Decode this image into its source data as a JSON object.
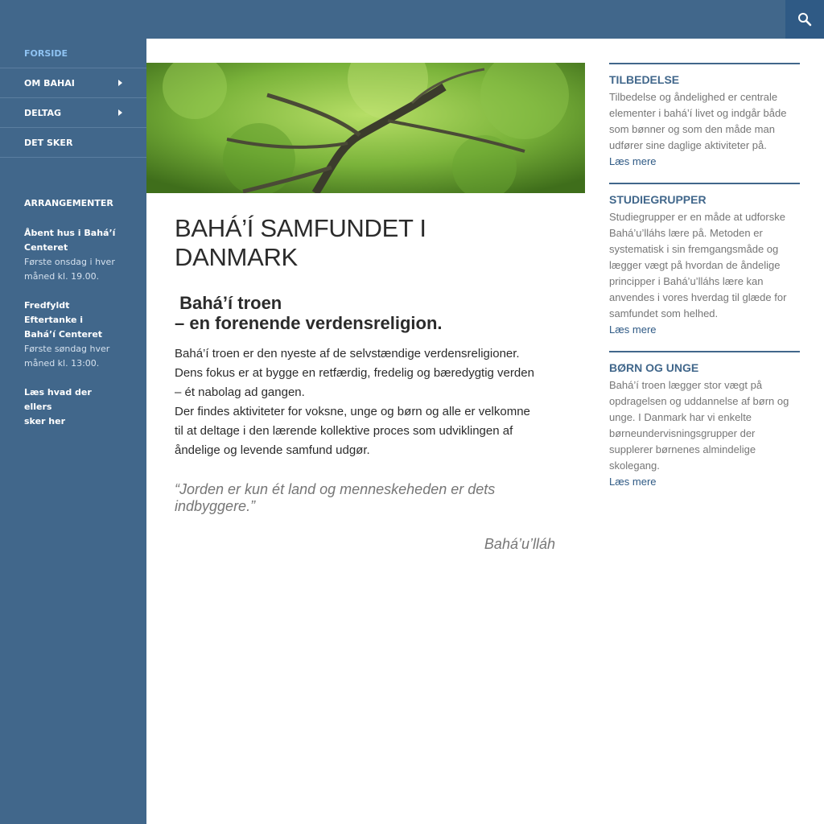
{
  "search": {
    "icon": "search-icon"
  },
  "nav": {
    "items": [
      {
        "label": "FORSIDE",
        "active": true,
        "has_submenu": false
      },
      {
        "label": "OM BAHAI",
        "active": false,
        "has_submenu": true
      },
      {
        "label": "DELTAG",
        "active": false,
        "has_submenu": true
      },
      {
        "label": "DET SKER",
        "active": false,
        "has_submenu": false
      }
    ]
  },
  "sidebar_widget": {
    "heading": "ARRANGEMENTER",
    "events": [
      {
        "title_lines": [
          "Åbent hus i Bahá’í",
          "Centeret"
        ],
        "time_lines": [
          "Første onsdag i hver",
          "måned kl. 19.00."
        ]
      },
      {
        "title_lines": [
          "Fredfyldt Eftertanke i",
          "Bahá’í Centeret"
        ],
        "time_lines": [
          "Første søndag hver",
          "måned kl. 13:00."
        ]
      }
    ],
    "more_link_lines": [
      "Læs hvad der ellers",
      "sker her"
    ]
  },
  "hero": {
    "description": "tree canopy photo"
  },
  "main": {
    "title_lines": [
      "BAHÁ’Í SAMFUNDET I",
      "DANMARK"
    ],
    "subhead_lines": [
      " Bahá’í troen",
      "– en forenende verdensreligion."
    ],
    "body_lines": [
      "Bahá’í troen er den nyeste af de selvstændige verdensreligioner.",
      "Dens fokus er at bygge en retfærdig, fredelig og bæredygtig verden",
      "– ét nabolag ad gangen.",
      "Der findes aktiviteter for voksne, unge og børn og alle er velkomne",
      "til at deltage i den lærende kollektive proces som udviklingen af",
      "åndelige og levende samfund udgør."
    ],
    "quote": "“Jorden er kun ét land og menneskeheden er dets indbyggere.”",
    "quote_author": "Bahá’u’lláh"
  },
  "right_widgets": [
    {
      "title": "TILBEDELSE",
      "lines": [
        "Tilbedelse og åndelighed er centrale",
        "elementer i bahá’í livet og indgår både",
        "som bønner og som den måde man",
        "udfører sine daglige aktiviteter på."
      ],
      "link": "Læs mere"
    },
    {
      "title": "STUDIEGRUPPER",
      "lines": [
        "Studiegrupper er en måde at udforske",
        "Bahá’u’lláhs lære på. Metoden er",
        "systematisk i sin fremgangsmåde og",
        "lægger vægt på hvordan de åndelige",
        "principper i Bahá’u’lláhs lære kan",
        "anvendes i vores hverdag til glæde for",
        "samfundet som helhed."
      ],
      "link": "Læs mere"
    },
    {
      "title": "BØRN OG UNGE",
      "lines": [
        "Bahá’í troen lægger stor vægt på",
        "opdragelsen og uddannelse af børn og",
        "unge. I Danmark har vi enkelte",
        "børneundervisningsgrupper der",
        "supplerer børnenes almindelige",
        "skolegang."
      ],
      "link": "Læs mere"
    }
  ],
  "colors": {
    "brand": "#41678b",
    "accent": "#8fc3f2",
    "search_bg": "#2f5a85"
  }
}
